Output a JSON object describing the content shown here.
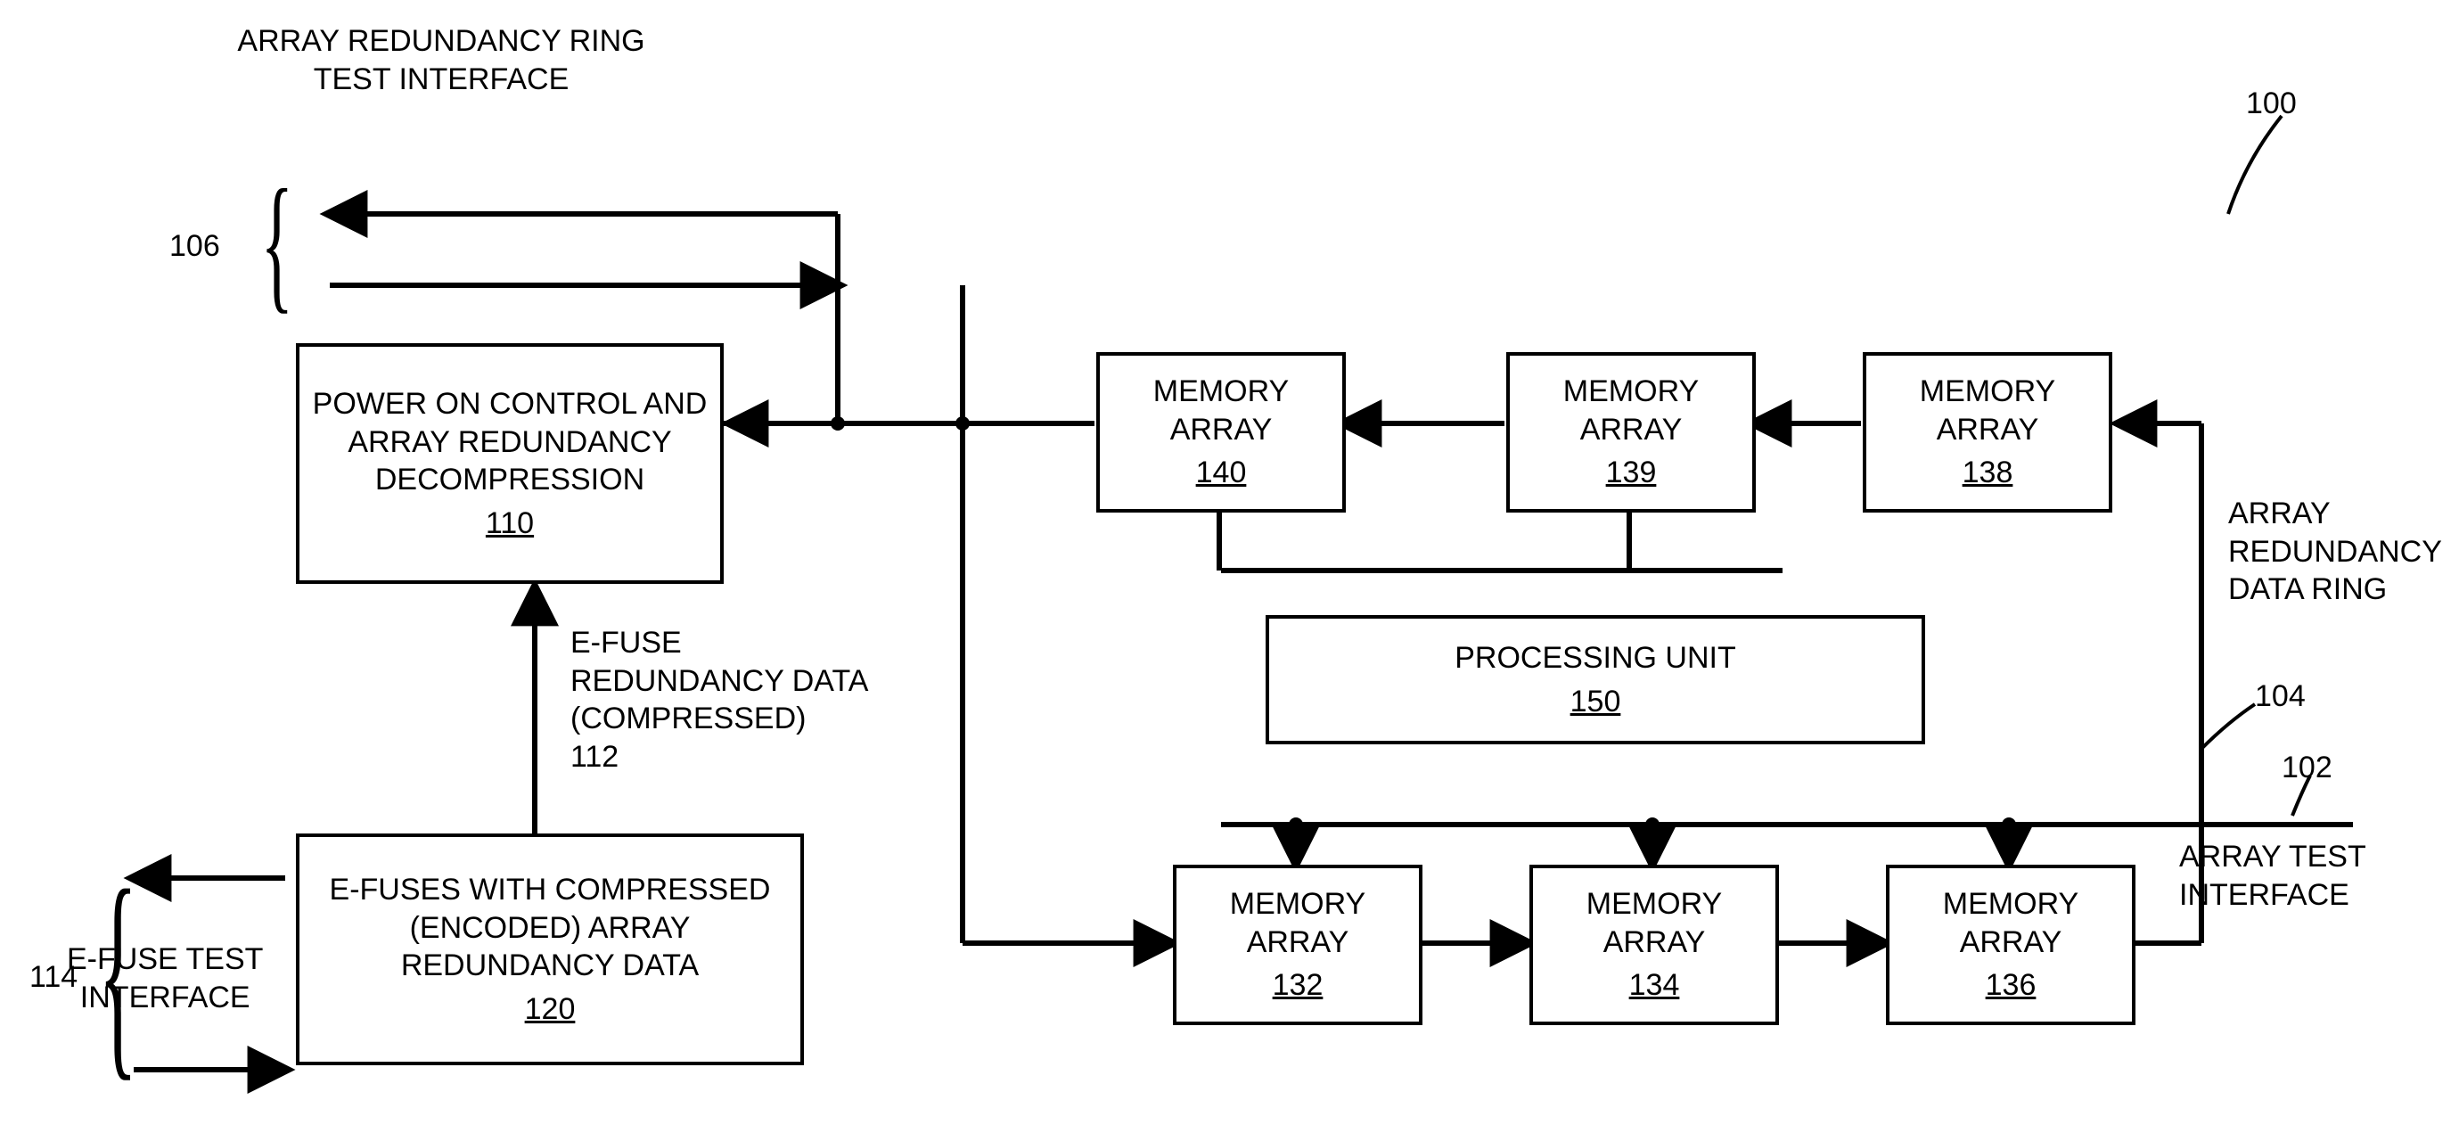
{
  "figure_ref_100": "100",
  "title_top": "ARRAY REDUNDANCY RING\nTEST INTERFACE",
  "ref_106": "106",
  "block_power": {
    "text": "POWER ON CONTROL AND\nARRAY REDUNDANCY\nDECOMPRESSION",
    "ref": "110"
  },
  "efuse_data_label": "E-FUSE\nREDUNDANCY DATA\n(COMPRESSED)\n112",
  "block_efuses": {
    "text": "E-FUSES WITH\nCOMPRESSED (ENCODED)\nARRAY REDUNDANCY DATA",
    "ref": "120"
  },
  "efuse_test_iface": "E-FUSE TEST\nINTERFACE",
  "ref_114": "114",
  "mem_140": {
    "text": "MEMORY\nARRAY",
    "ref": "140"
  },
  "mem_139": {
    "text": "MEMORY\nARRAY",
    "ref": "139"
  },
  "mem_138": {
    "text": "MEMORY\nARRAY",
    "ref": "138"
  },
  "pu": {
    "text": "PROCESSING UNIT",
    "ref": "150"
  },
  "mem_132": {
    "text": "MEMORY\nARRAY",
    "ref": "132"
  },
  "mem_134": {
    "text": "MEMORY\nARRAY",
    "ref": "134"
  },
  "mem_136": {
    "text": "MEMORY\nARRAY",
    "ref": "136"
  },
  "ring_label": "ARRAY\nREDUNDANCY\nDATA RING",
  "ref_104": "104",
  "ref_102": "102",
  "array_test_iface": "ARRAY TEST\nINTERFACE"
}
